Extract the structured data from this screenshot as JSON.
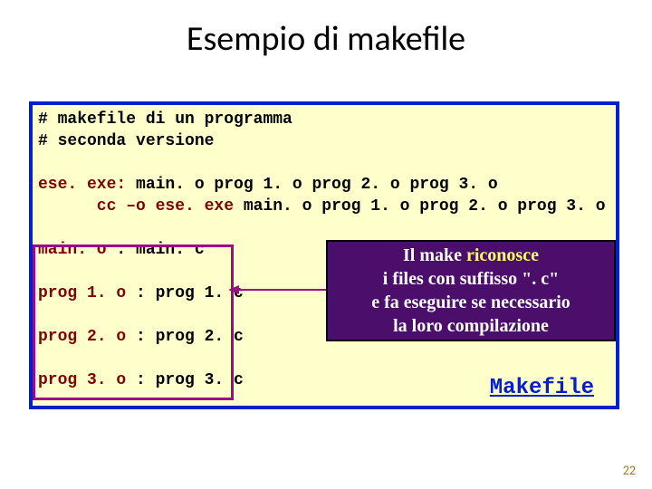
{
  "title": "Esempio di makefile",
  "code": {
    "c1": "# makefile di un programma",
    "c2": "# seconda versione",
    "blank1": "",
    "r1a": "ese. exe:",
    "r1b": " main. o prog 1. o prog 2. o prog 3. o",
    "r2a": "      cc –o ese. exe",
    "r2b": " main. o prog 1. o prog 2. o prog 3. o",
    "blank2": "",
    "d1a": "main. o",
    "d1b": " : main. c",
    "blank3": "",
    "d2a": "prog 1. o",
    "d2b": " : prog 1. c",
    "blank4": "",
    "d3a": "prog 2. o",
    "d3b": " : prog 2. c",
    "blank5": "",
    "d4a": "prog 3. o",
    "d4b": " : prog 3. c"
  },
  "makefile_label": "Makefile",
  "callout": {
    "l1a": "Il make ",
    "l1b": "riconosce",
    "l2": "i files con suffisso \". c\"",
    "l3": "e fa eseguire se necessario",
    "l4": "la loro compilazione"
  },
  "page_number": "22"
}
